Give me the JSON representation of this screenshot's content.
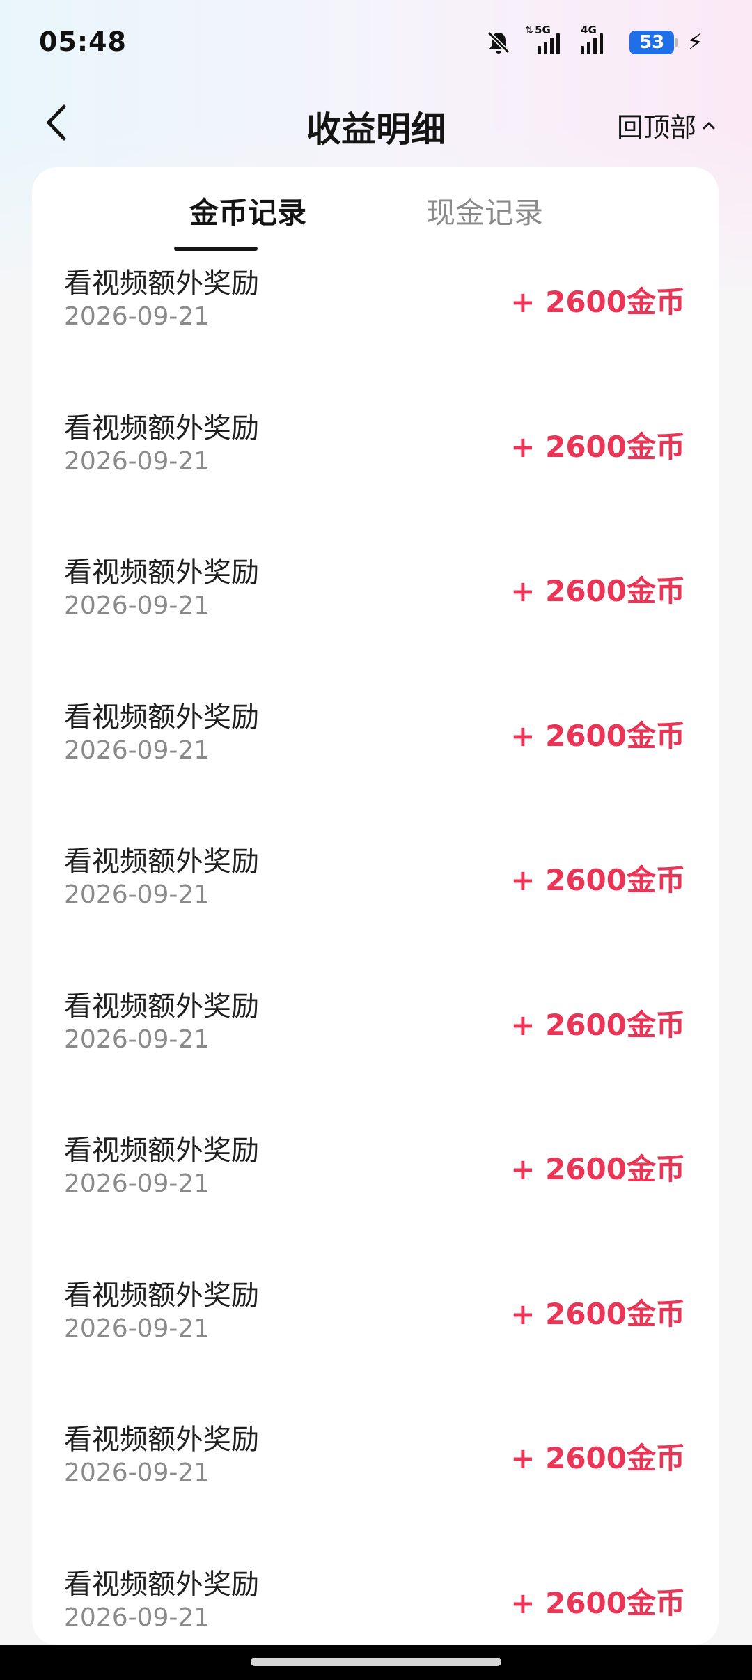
{
  "status_bar": {
    "time": "05:48",
    "network_5g": "5G",
    "network_4g": "4G",
    "battery": "53",
    "icons": [
      "bell-muted-icon",
      "signal-5g-icon",
      "signal-4g-icon",
      "battery-icon",
      "charging-bolt-icon"
    ]
  },
  "header": {
    "title": "收益明细",
    "back_to_top": "回顶部"
  },
  "tabs": [
    {
      "label": "金币记录",
      "active": true
    },
    {
      "label": "现金记录",
      "active": false
    }
  ],
  "records": [
    {
      "title": "看视频额外奖励",
      "date": "2026-09-21",
      "amount": "+ 2600金币"
    },
    {
      "title": "看视频额外奖励",
      "date": "2026-09-21",
      "amount": "+ 2600金币"
    },
    {
      "title": "看视频额外奖励",
      "date": "2026-09-21",
      "amount": "+ 2600金币"
    },
    {
      "title": "看视频额外奖励",
      "date": "2026-09-21",
      "amount": "+ 2600金币"
    },
    {
      "title": "看视频额外奖励",
      "date": "2026-09-21",
      "amount": "+ 2600金币"
    },
    {
      "title": "看视频额外奖励",
      "date": "2026-09-21",
      "amount": "+ 2600金币"
    },
    {
      "title": "看视频额外奖励",
      "date": "2026-09-21",
      "amount": "+ 2600金币"
    },
    {
      "title": "看视频额外奖励",
      "date": "2026-09-21",
      "amount": "+ 2600金币"
    },
    {
      "title": "看视频额外奖励",
      "date": "2026-09-21",
      "amount": "+ 2600金币"
    },
    {
      "title": "看视频额外奖励",
      "date": "2026-09-21",
      "amount": "+ 2600金币"
    }
  ],
  "colors": {
    "accent": "#ea3556",
    "battery": "#1f6fe8"
  }
}
